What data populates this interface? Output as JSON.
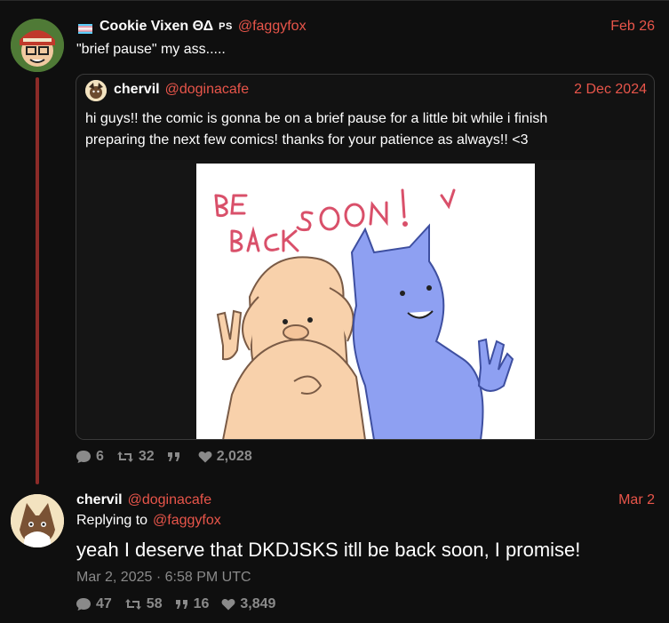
{
  "tweet": {
    "author_name": "Cookie Vixen ΘΔ",
    "author_badge": "PS",
    "author_handle": "@faggyfox",
    "date": "Feb 26",
    "text": "\"brief pause\" my ass.....",
    "stats": {
      "replies": "6",
      "retweets": "32",
      "quotes": "",
      "likes": "2,028"
    }
  },
  "quote": {
    "author_name": "chervil",
    "author_handle": "@doginacafe",
    "date": "2 Dec 2024",
    "text_line1": "hi guys!! the comic is gonna be on a brief pause for a little bit while i  finish",
    "text_line2": "preparing the next few comics! thanks for your patience as  always!! <3",
    "image_text": "BE BACK SOON!"
  },
  "reply": {
    "author_name": "chervil",
    "author_handle": "@doginacafe",
    "date": "Mar 2",
    "replying_label": "Replying to",
    "replying_to": "@faggyfox",
    "text": "yeah I deserve that DKDJSKS itll be back soon, I promise!",
    "timestamp": "Mar 2, 2025 · 6:58 PM UTC",
    "stats": {
      "replies": "47",
      "retweets": "58",
      "quotes": "16",
      "likes": "3,849"
    }
  },
  "colors": {
    "accent": "#e8554a",
    "muted": "#8a8a8a",
    "thread": "#8c2b28",
    "background": "#0f0f0f"
  }
}
